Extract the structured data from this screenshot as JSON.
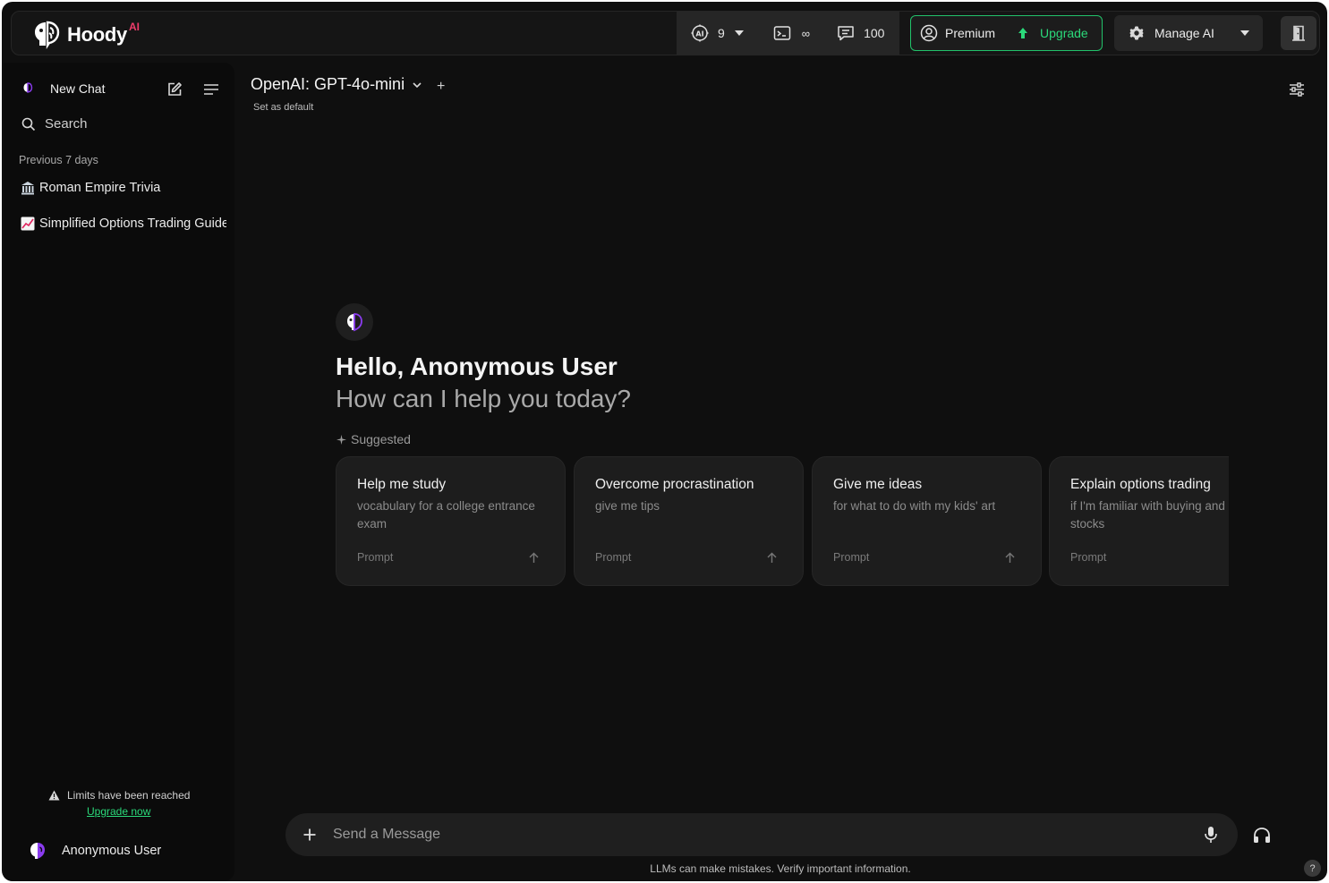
{
  "brand": {
    "name": "Hoody",
    "superscript": "AI",
    "accent_color": "#ef3c6b"
  },
  "topbar": {
    "ai_models_count": "9",
    "terminal_count": "∞",
    "messages_count": "100",
    "premium_label": "Premium",
    "upgrade_label": "Upgrade",
    "manage_label": "Manage AI",
    "icons": [
      "ai-chip-icon",
      "terminal-icon",
      "message-icon",
      "user-circle-icon",
      "arrow-up-icon",
      "gear-icon",
      "door-icon"
    ]
  },
  "sidebar": {
    "new_chat_label": "New Chat",
    "search_label": "Search",
    "section_label": "Previous 7 days",
    "chats": [
      {
        "icon": "🏛",
        "title": "Roman Empire Trivia"
      },
      {
        "icon": "📈",
        "title": "Simplified Options Trading Guide"
      }
    ],
    "limits_text": "Limits have been reached",
    "upgrade_now_label": "Upgrade now",
    "user_name": "Anonymous User"
  },
  "main": {
    "model_name": "OpenAI: GPT-4o-mini",
    "add_model_label": "+",
    "set_default_label": "Set as default",
    "greeting": "Hello, Anonymous User",
    "subgreeting": "How can I help you today?",
    "suggested_label": "Suggested",
    "cards": [
      {
        "title": "Help me study",
        "subtitle": "vocabulary for a college entrance exam",
        "prompt_label": "Prompt"
      },
      {
        "title": "Overcome procrastination",
        "subtitle": "give me tips",
        "prompt_label": "Prompt"
      },
      {
        "title": "Give me ideas",
        "subtitle": "for what to do with my kids' art",
        "prompt_label": "Prompt"
      },
      {
        "title": "Explain options trading",
        "subtitle": "if I'm familiar with buying and selling stocks",
        "prompt_label": "Prompt"
      }
    ],
    "composer_placeholder": "Send a Message",
    "disclaimer": "LLMs can make mistakes. Verify important information.",
    "help_label": "?"
  },
  "colors": {
    "background": "#0f0f0f",
    "sidebar": "#0b0b0b",
    "green": "#2bd97a",
    "card": "#1d1d1d"
  }
}
